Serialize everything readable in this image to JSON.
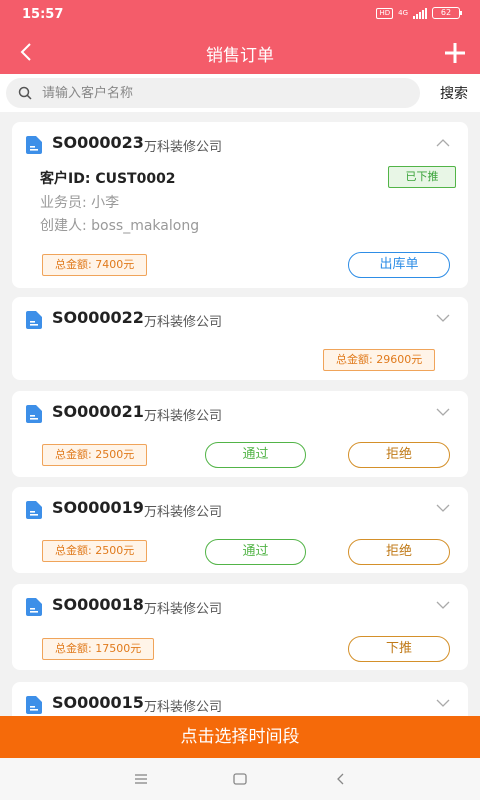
{
  "status": {
    "time": "15:57",
    "hd": "HD",
    "net": "4G",
    "battery": "62"
  },
  "header": {
    "title": "销售订单",
    "back_icon": "chevron-left-icon",
    "add_icon": "plus-icon"
  },
  "search": {
    "placeholder": "请输入客户名称",
    "value": "",
    "button_label": "搜索"
  },
  "labels": {
    "customer_id": "客户ID: ",
    "salesman": "业务员: ",
    "creator": "创建人: ",
    "amount": "总金额: "
  },
  "orders": [
    {
      "order_no": "SO000023",
      "customer": "万科装修公司",
      "customer_id": "CUST0002",
      "salesman": "小李",
      "creator": "boss_makalong",
      "status_tag": "已下推",
      "amount": "7400元",
      "action": "出库单",
      "expanded": true
    },
    {
      "order_no": "SO000022",
      "customer": "万科装修公司",
      "amount": "29600元"
    },
    {
      "order_no": "SO000021",
      "customer": "万科装修公司",
      "amount": "2500元",
      "approve": "通过",
      "reject": "拒绝"
    },
    {
      "order_no": "SO000019",
      "customer": "万科装修公司",
      "amount": "2500元",
      "approve": "通过",
      "reject": "拒绝"
    },
    {
      "order_no": "SO000018",
      "customer": "万科装修公司",
      "amount": "17500元",
      "action": "下推"
    },
    {
      "order_no": "SO000015",
      "customer": "万科装修公司"
    }
  ],
  "bottom_button": "点击选择时间段",
  "colors": {
    "header": "#f45c6a",
    "bottom_button": "#f56a0a",
    "blue": "#2e8de6",
    "green": "#52b447",
    "orange": "#d4902a"
  }
}
